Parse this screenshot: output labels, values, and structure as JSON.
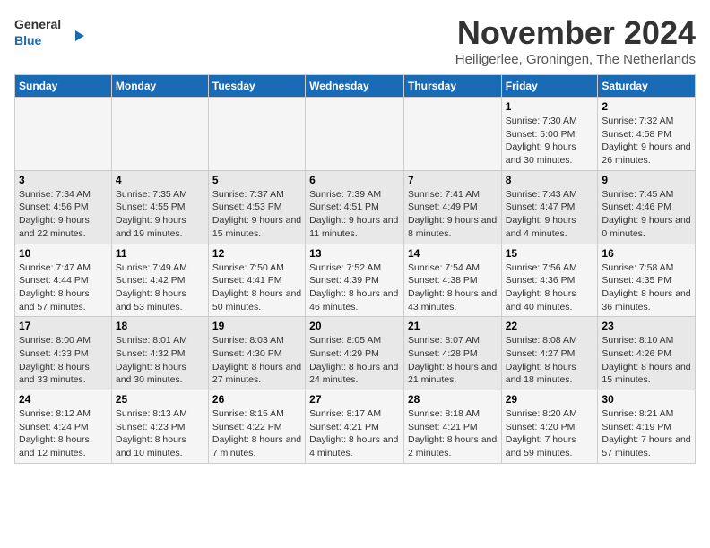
{
  "logo": {
    "line1": "General",
    "line2": "Blue"
  },
  "title": "November 2024",
  "location": "Heiligerlee, Groningen, The Netherlands",
  "weekdays": [
    "Sunday",
    "Monday",
    "Tuesday",
    "Wednesday",
    "Thursday",
    "Friday",
    "Saturday"
  ],
  "weeks": [
    [
      {
        "day": "",
        "info": ""
      },
      {
        "day": "",
        "info": ""
      },
      {
        "day": "",
        "info": ""
      },
      {
        "day": "",
        "info": ""
      },
      {
        "day": "",
        "info": ""
      },
      {
        "day": "1",
        "info": "Sunrise: 7:30 AM\nSunset: 5:00 PM\nDaylight: 9 hours and 30 minutes."
      },
      {
        "day": "2",
        "info": "Sunrise: 7:32 AM\nSunset: 4:58 PM\nDaylight: 9 hours and 26 minutes."
      }
    ],
    [
      {
        "day": "3",
        "info": "Sunrise: 7:34 AM\nSunset: 4:56 PM\nDaylight: 9 hours and 22 minutes."
      },
      {
        "day": "4",
        "info": "Sunrise: 7:35 AM\nSunset: 4:55 PM\nDaylight: 9 hours and 19 minutes."
      },
      {
        "day": "5",
        "info": "Sunrise: 7:37 AM\nSunset: 4:53 PM\nDaylight: 9 hours and 15 minutes."
      },
      {
        "day": "6",
        "info": "Sunrise: 7:39 AM\nSunset: 4:51 PM\nDaylight: 9 hours and 11 minutes."
      },
      {
        "day": "7",
        "info": "Sunrise: 7:41 AM\nSunset: 4:49 PM\nDaylight: 9 hours and 8 minutes."
      },
      {
        "day": "8",
        "info": "Sunrise: 7:43 AM\nSunset: 4:47 PM\nDaylight: 9 hours and 4 minutes."
      },
      {
        "day": "9",
        "info": "Sunrise: 7:45 AM\nSunset: 4:46 PM\nDaylight: 9 hours and 0 minutes."
      }
    ],
    [
      {
        "day": "10",
        "info": "Sunrise: 7:47 AM\nSunset: 4:44 PM\nDaylight: 8 hours and 57 minutes."
      },
      {
        "day": "11",
        "info": "Sunrise: 7:49 AM\nSunset: 4:42 PM\nDaylight: 8 hours and 53 minutes."
      },
      {
        "day": "12",
        "info": "Sunrise: 7:50 AM\nSunset: 4:41 PM\nDaylight: 8 hours and 50 minutes."
      },
      {
        "day": "13",
        "info": "Sunrise: 7:52 AM\nSunset: 4:39 PM\nDaylight: 8 hours and 46 minutes."
      },
      {
        "day": "14",
        "info": "Sunrise: 7:54 AM\nSunset: 4:38 PM\nDaylight: 8 hours and 43 minutes."
      },
      {
        "day": "15",
        "info": "Sunrise: 7:56 AM\nSunset: 4:36 PM\nDaylight: 8 hours and 40 minutes."
      },
      {
        "day": "16",
        "info": "Sunrise: 7:58 AM\nSunset: 4:35 PM\nDaylight: 8 hours and 36 minutes."
      }
    ],
    [
      {
        "day": "17",
        "info": "Sunrise: 8:00 AM\nSunset: 4:33 PM\nDaylight: 8 hours and 33 minutes."
      },
      {
        "day": "18",
        "info": "Sunrise: 8:01 AM\nSunset: 4:32 PM\nDaylight: 8 hours and 30 minutes."
      },
      {
        "day": "19",
        "info": "Sunrise: 8:03 AM\nSunset: 4:30 PM\nDaylight: 8 hours and 27 minutes."
      },
      {
        "day": "20",
        "info": "Sunrise: 8:05 AM\nSunset: 4:29 PM\nDaylight: 8 hours and 24 minutes."
      },
      {
        "day": "21",
        "info": "Sunrise: 8:07 AM\nSunset: 4:28 PM\nDaylight: 8 hours and 21 minutes."
      },
      {
        "day": "22",
        "info": "Sunrise: 8:08 AM\nSunset: 4:27 PM\nDaylight: 8 hours and 18 minutes."
      },
      {
        "day": "23",
        "info": "Sunrise: 8:10 AM\nSunset: 4:26 PM\nDaylight: 8 hours and 15 minutes."
      }
    ],
    [
      {
        "day": "24",
        "info": "Sunrise: 8:12 AM\nSunset: 4:24 PM\nDaylight: 8 hours and 12 minutes."
      },
      {
        "day": "25",
        "info": "Sunrise: 8:13 AM\nSunset: 4:23 PM\nDaylight: 8 hours and 10 minutes."
      },
      {
        "day": "26",
        "info": "Sunrise: 8:15 AM\nSunset: 4:22 PM\nDaylight: 8 hours and 7 minutes."
      },
      {
        "day": "27",
        "info": "Sunrise: 8:17 AM\nSunset: 4:21 PM\nDaylight: 8 hours and 4 minutes."
      },
      {
        "day": "28",
        "info": "Sunrise: 8:18 AM\nSunset: 4:21 PM\nDaylight: 8 hours and 2 minutes."
      },
      {
        "day": "29",
        "info": "Sunrise: 8:20 AM\nSunset: 4:20 PM\nDaylight: 7 hours and 59 minutes."
      },
      {
        "day": "30",
        "info": "Sunrise: 8:21 AM\nSunset: 4:19 PM\nDaylight: 7 hours and 57 minutes."
      }
    ]
  ]
}
